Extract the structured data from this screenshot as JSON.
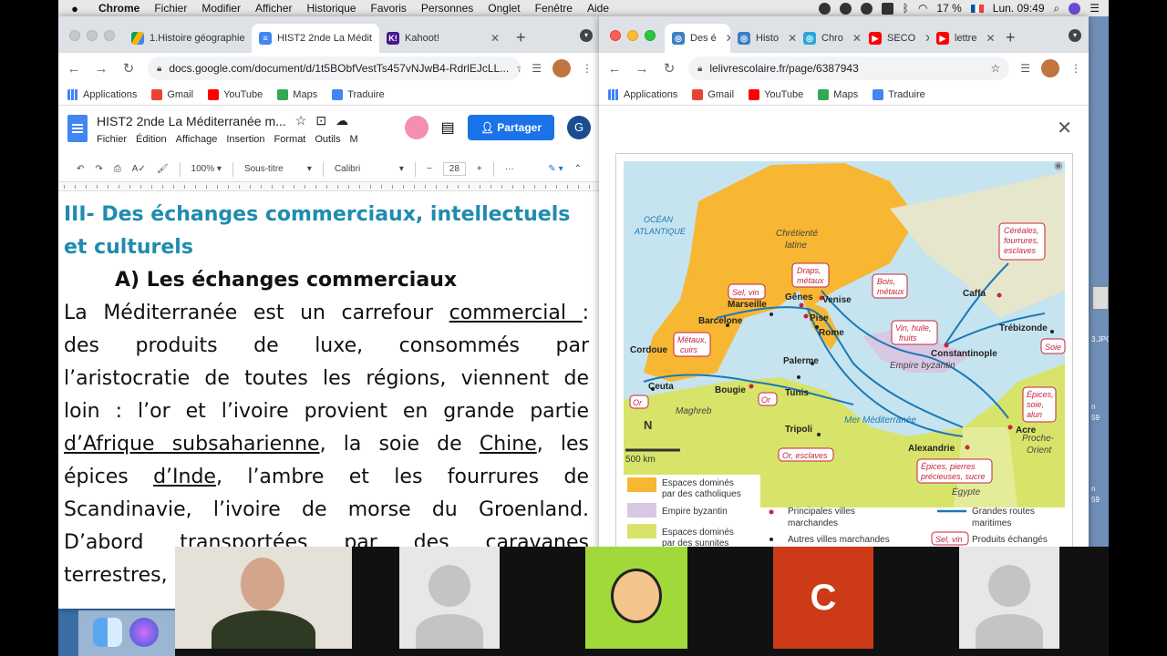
{
  "menubar": {
    "app": "Chrome",
    "items": [
      "Fichier",
      "Modifier",
      "Afficher",
      "Historique",
      "Favoris",
      "Personnes",
      "Onglet",
      "Fenêtre",
      "Aide"
    ],
    "battery": "17 %",
    "clock": "Lun. 09:49"
  },
  "left_window": {
    "tabs": [
      {
        "label": "1.Histoire géographie",
        "icon": "drive-icon"
      },
      {
        "label": "HIST2 2nde La Médit",
        "icon": "docs-icon"
      },
      {
        "label": "Kahoot!",
        "icon": "kahoot-icon"
      }
    ],
    "url": "docs.google.com/document/d/1t5BObfVestTs457vNJwB4-RdrlEJcLL...",
    "bookmarks": [
      "Applications",
      "Gmail",
      "YouTube",
      "Maps",
      "Traduire"
    ],
    "doc_title": "HIST2 2nde La Méditerranée m...",
    "doc_menus": [
      "Fichier",
      "Édition",
      "Affichage",
      "Insertion",
      "Format",
      "Outils",
      "M"
    ],
    "share_label": "Partager",
    "account_initial": "G",
    "toolbar": {
      "zoom": "100%",
      "style": "Sous-titre",
      "font": "Calibri",
      "size": "28",
      "minus": "−",
      "plus": "+",
      "more": "···"
    },
    "heading1_line1": "III- Des échanges commerciaux, intellectuels",
    "heading1_line2": "et culturels",
    "heading2": "A)  Les échanges commerciaux",
    "paragraph": [
      [
        "La Méditerranée est un carrefour ",
        "commercial ",
        ":"
      ],
      [
        "des produits de luxe, consommés par"
      ],
      [
        "l’aristocratie de toutes les régions, viennent de"
      ],
      [
        "loin : l’or et l’ivoire provient en grande partie"
      ],
      [
        "d’Afrique subsaharienne",
        ", la soie de ",
        "Chine",
        ", les"
      ],
      [
        "épices ",
        "d’Inde",
        ", l’ambre et les fourrures de"
      ],
      [
        "Scandinavie, l’ivoire de morse du Groenland."
      ],
      [
        "D’abord transportées par des caravanes"
      ],
      [
        "terrestres,"
      ]
    ]
  },
  "right_window": {
    "tabs": [
      {
        "label": "Des é",
        "icon": "lelivre-icon"
      },
      {
        "label": "Histo",
        "icon": "lelivre-icon"
      },
      {
        "label": "Chro",
        "icon": "lelivre-icon"
      },
      {
        "label": "SECO",
        "icon": "youtube-icon"
      },
      {
        "label": "lettre",
        "icon": "youtube-icon"
      }
    ],
    "url": "lelivrescolaire.fr/page/6387943",
    "bookmarks": [
      "Applications",
      "Gmail",
      "YouTube",
      "Maps",
      "Traduire"
    ],
    "close": "✕"
  },
  "map": {
    "labels": {
      "ocean": [
        "OCÉAN",
        "ATLANTIQUE"
      ],
      "chretiente": [
        "Chrétienté",
        "latine"
      ],
      "empire": "Empire byzantin",
      "mer": "Mer Méditerranée",
      "maghreb": "Maghreb",
      "proche": [
        "Proche-",
        "Orient"
      ],
      "egypte": "Égypte",
      "scale": "500 km",
      "north": "N"
    },
    "cities": [
      {
        "name": "Cordoue",
        "kind": "principale"
      },
      {
        "name": "Barcelone",
        "kind": "autre"
      },
      {
        "name": "Marseille",
        "kind": "autre"
      },
      {
        "name": "Gênes",
        "kind": "principale"
      },
      {
        "name": "Venise",
        "kind": "principale"
      },
      {
        "name": "Pise",
        "kind": "principale"
      },
      {
        "name": "Rome",
        "kind": "autre"
      },
      {
        "name": "Palerme",
        "kind": "autre"
      },
      {
        "name": "Tunis",
        "kind": "autre"
      },
      {
        "name": "Bougie",
        "kind": "principale"
      },
      {
        "name": "Ceuta",
        "kind": "autre"
      },
      {
        "name": "Tripoli",
        "kind": "autre"
      },
      {
        "name": "Alexandrie",
        "kind": "principale"
      },
      {
        "name": "Acre",
        "kind": "principale"
      },
      {
        "name": "Constantinople",
        "kind": "principale"
      },
      {
        "name": "Trébizonde",
        "kind": "autre"
      },
      {
        "name": "Caffa",
        "kind": "principale"
      }
    ],
    "products": [
      [
        "Céréales,",
        "fourrures,",
        "esclaves"
      ],
      [
        "Draps,",
        "métaux"
      ],
      [
        "Bois,",
        "métaux"
      ],
      [
        "Sel, vin"
      ],
      [
        "Métaux,",
        "cuirs"
      ],
      [
        "Vin, huile,",
        "fruits"
      ],
      [
        "Soie"
      ],
      [
        "Épices,",
        "soie,",
        "alun"
      ],
      [
        "Or"
      ],
      [
        "Or"
      ],
      [
        "Or, esclaves"
      ],
      [
        "Épices, pierres",
        "précieuses, sucre"
      ]
    ],
    "legend": {
      "catholiques": [
        "Espaces dominés",
        "par des catholiques"
      ],
      "byzantin": "Empire byzantin",
      "sunnites": [
        "Espaces dominés",
        "par des sunnites"
      ],
      "principales": [
        "Principales villes",
        "marchandes"
      ],
      "autres": "Autres villes marchandes",
      "routes": [
        "Grandes routes",
        "maritimes"
      ],
      "produits_sample": "Sel, vin",
      "produits": "Produits échangés"
    },
    "colors": {
      "sea": "#c5e4ef",
      "catholic": "#f7b733",
      "byzantine": "#d9c8e4",
      "sunni": "#d8e36a",
      "route": "#1b79b8",
      "product": "#c8233a"
    }
  },
  "zoom": {
    "tile_c_initial": "C"
  },
  "desktop": {
    "labels": [
      "3.JPG",
      "n",
      "59",
      "n",
      "59"
    ]
  }
}
